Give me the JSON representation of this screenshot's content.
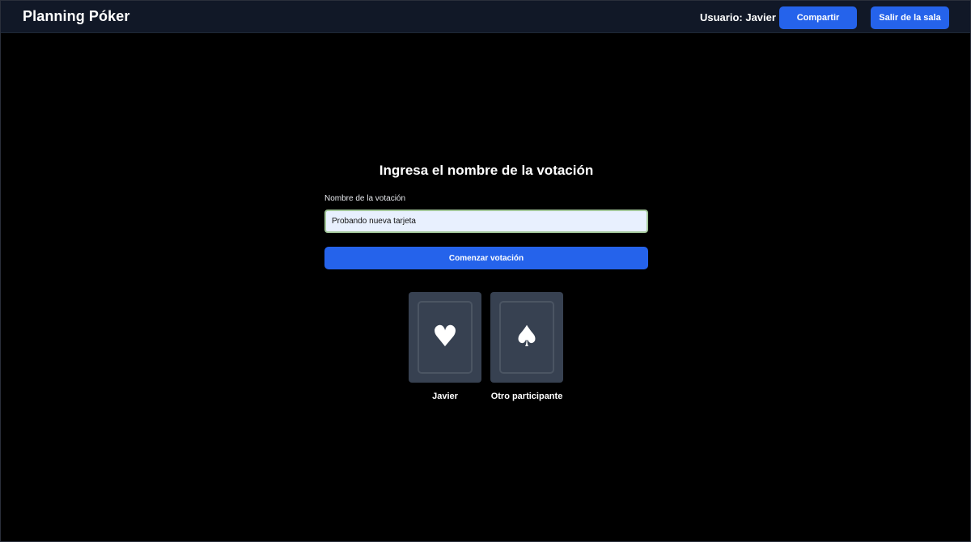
{
  "header": {
    "app_title": "Planning Póker",
    "user_label": "Usuario: Javier",
    "share_label": "Compartir",
    "leave_label": "Salir de la sala"
  },
  "vote_form": {
    "title": "Ingresa el nombre de la votación",
    "field_label": "Nombre de la votación",
    "field_value": "Probando nueva tarjeta",
    "start_label": "Comenzar votación"
  },
  "participants": [
    {
      "name": "Javier",
      "suit_icon": "heart-icon",
      "suit_glyph": "♥"
    },
    {
      "name": "Otro participante",
      "suit_icon": "spade-icon",
      "suit_glyph": "♠"
    }
  ],
  "colors": {
    "background": "#000000",
    "header_bg": "#111827",
    "accent": "#2563eb",
    "card_bg": "#374151",
    "input_bg": "#e8f0fe",
    "input_border_focus": "#a3c79a"
  }
}
